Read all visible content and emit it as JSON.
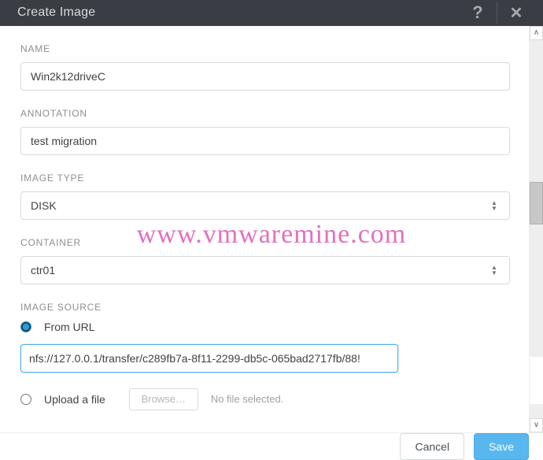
{
  "header": {
    "title": "Create Image",
    "help_icon": "?",
    "close_icon": "✕"
  },
  "form": {
    "name": {
      "label": "NAME",
      "value": "Win2k12driveC"
    },
    "annotation": {
      "label": "ANNOTATION",
      "value": "test migration"
    },
    "image_type": {
      "label": "IMAGE TYPE",
      "selected": "DISK"
    },
    "container": {
      "label": "CONTAINER",
      "selected": "ctr01"
    },
    "image_source": {
      "label": "IMAGE SOURCE",
      "from_url": {
        "label": "From URL",
        "value": "nfs://127.0.0.1/transfer/c289fb7a-8f11-2299-db5c-065bad2717fb/88!"
      },
      "upload": {
        "label": "Upload a file",
        "browse": "Browse…",
        "status": "No file selected."
      }
    }
  },
  "footer": {
    "cancel": "Cancel",
    "save": "Save"
  },
  "watermark": "www.vmwaremine.com"
}
